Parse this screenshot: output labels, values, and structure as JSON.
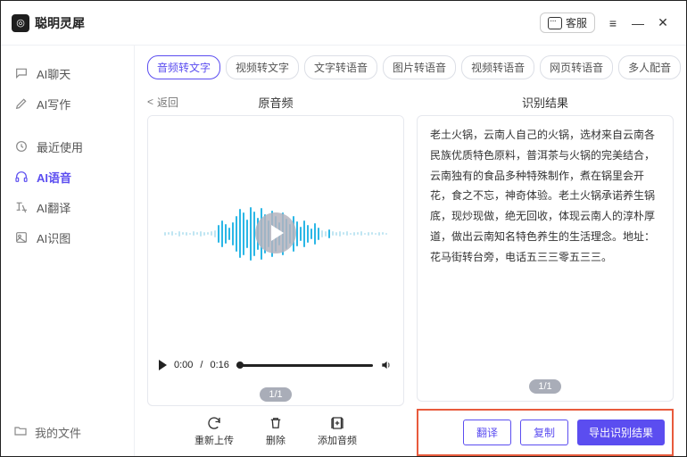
{
  "app_name": "聪明灵犀",
  "titlebar": {
    "kefu": "客服"
  },
  "sidebar": {
    "items": [
      {
        "label": "AI聊天"
      },
      {
        "label": "AI写作"
      },
      {
        "label": "最近使用"
      },
      {
        "label": "AI语音"
      },
      {
        "label": "AI翻译"
      },
      {
        "label": "AI识图"
      }
    ],
    "bottom": "我的文件"
  },
  "tabs": [
    "音频转文字",
    "视频转文字",
    "文字转语音",
    "图片转语音",
    "视频转语音",
    "网页转语音",
    "多人配音"
  ],
  "active_tab_index": 0,
  "left_panel": {
    "back": "返回",
    "title": "原音频",
    "time_current": "0:00",
    "time_total": "0:16",
    "pager": "1/1",
    "actions": {
      "reupload": "重新上传",
      "delete": "删除",
      "add": "添加音频"
    }
  },
  "right_panel": {
    "title": "识别结果",
    "text": "老土火锅，云南人自己的火锅，选材来自云南各民族优质特色原料，普洱茶与火锅的完美结合，云南独有的食品多种特殊制作，煮在锅里会开花，食之不忘，神奇体验。老土火锅承诺养生锅底，现炒现做，绝无回收，体现云南人的淳朴厚道，做出云南知名特色养生的生活理念。地址：花马街转台旁，电话五三三零五三三。",
    "pager": "1/1",
    "buttons": {
      "translate": "翻译",
      "copy": "复制",
      "export": "导出识别结果"
    }
  }
}
